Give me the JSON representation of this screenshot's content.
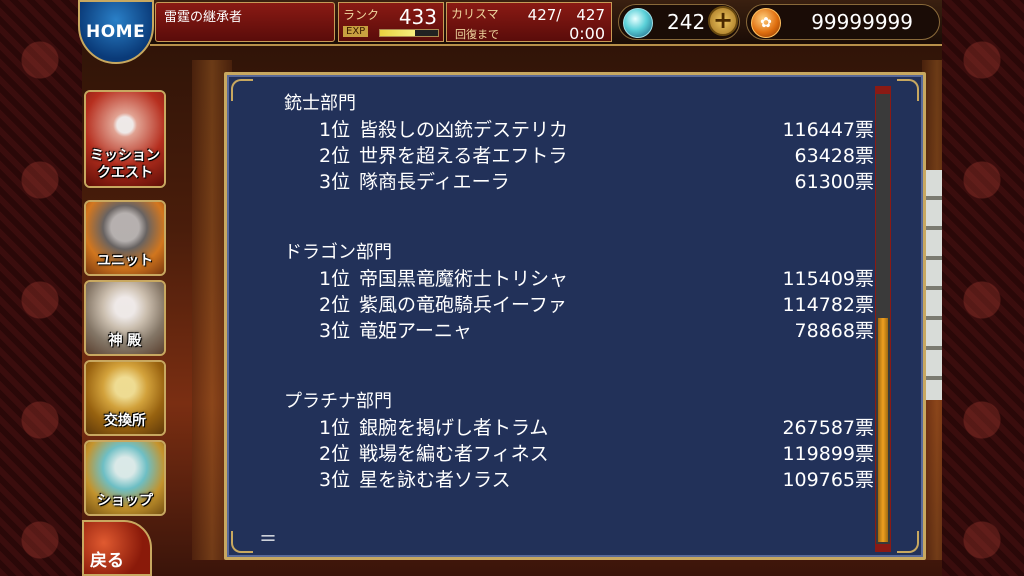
{
  "header": {
    "home_label": "HOME",
    "player_title": "雷霆の継承者",
    "rank_label": "ランク",
    "rank_value": "433",
    "exp_label": "EXP",
    "exp_progress": 0.6,
    "charisma_label": "カリスマ",
    "charisma_value": "427/　427",
    "recovery_label": "回復まで",
    "recovery_value": "0:00",
    "gems_icon": "crystal-icon",
    "gems_value": "242",
    "plus_label": "+",
    "gold_icon": "gold-coin-icon",
    "gold_value": "99999999"
  },
  "menu": {
    "items": [
      {
        "label": "ミッション\nクエスト",
        "icon": "mission-quest-icon"
      },
      {
        "label": "ユニット",
        "icon": "unit-icon"
      },
      {
        "label": "神 殿",
        "icon": "temple-icon"
      },
      {
        "label": "交換所",
        "icon": "exchange-icon"
      },
      {
        "label": "ショップ",
        "icon": "shop-icon"
      }
    ],
    "back_label": "戻る"
  },
  "results": {
    "categories": [
      {
        "title": "銃士部門",
        "entries": [
          {
            "rank": "1位",
            "name": "皆殺しの凶銃デステリカ",
            "votes": "116447票"
          },
          {
            "rank": "2位",
            "name": "世界を超える者エフトラ",
            "votes": "63428票"
          },
          {
            "rank": "3位",
            "name": "隊商長ディエーラ",
            "votes": "61300票"
          }
        ]
      },
      {
        "title": "ドラゴン部門",
        "entries": [
          {
            "rank": "1位",
            "name": "帝国黒竜魔術士トリシャ",
            "votes": "115409票"
          },
          {
            "rank": "2位",
            "name": "紫風の竜砲騎兵イーファ",
            "votes": "114782票"
          },
          {
            "rank": "3位",
            "name": "竜姫アーニャ",
            "votes": "78868票"
          }
        ]
      },
      {
        "title": "プラチナ部門",
        "entries": [
          {
            "rank": "1位",
            "name": "銀腕を掲げし者トラム",
            "votes": "267587票"
          },
          {
            "rank": "2位",
            "name": "戦場を編む者フィネス",
            "votes": "119899票"
          },
          {
            "rank": "3位",
            "name": "星を詠む者ソラス",
            "votes": "109765票"
          }
        ]
      }
    ],
    "footer": "＝"
  }
}
